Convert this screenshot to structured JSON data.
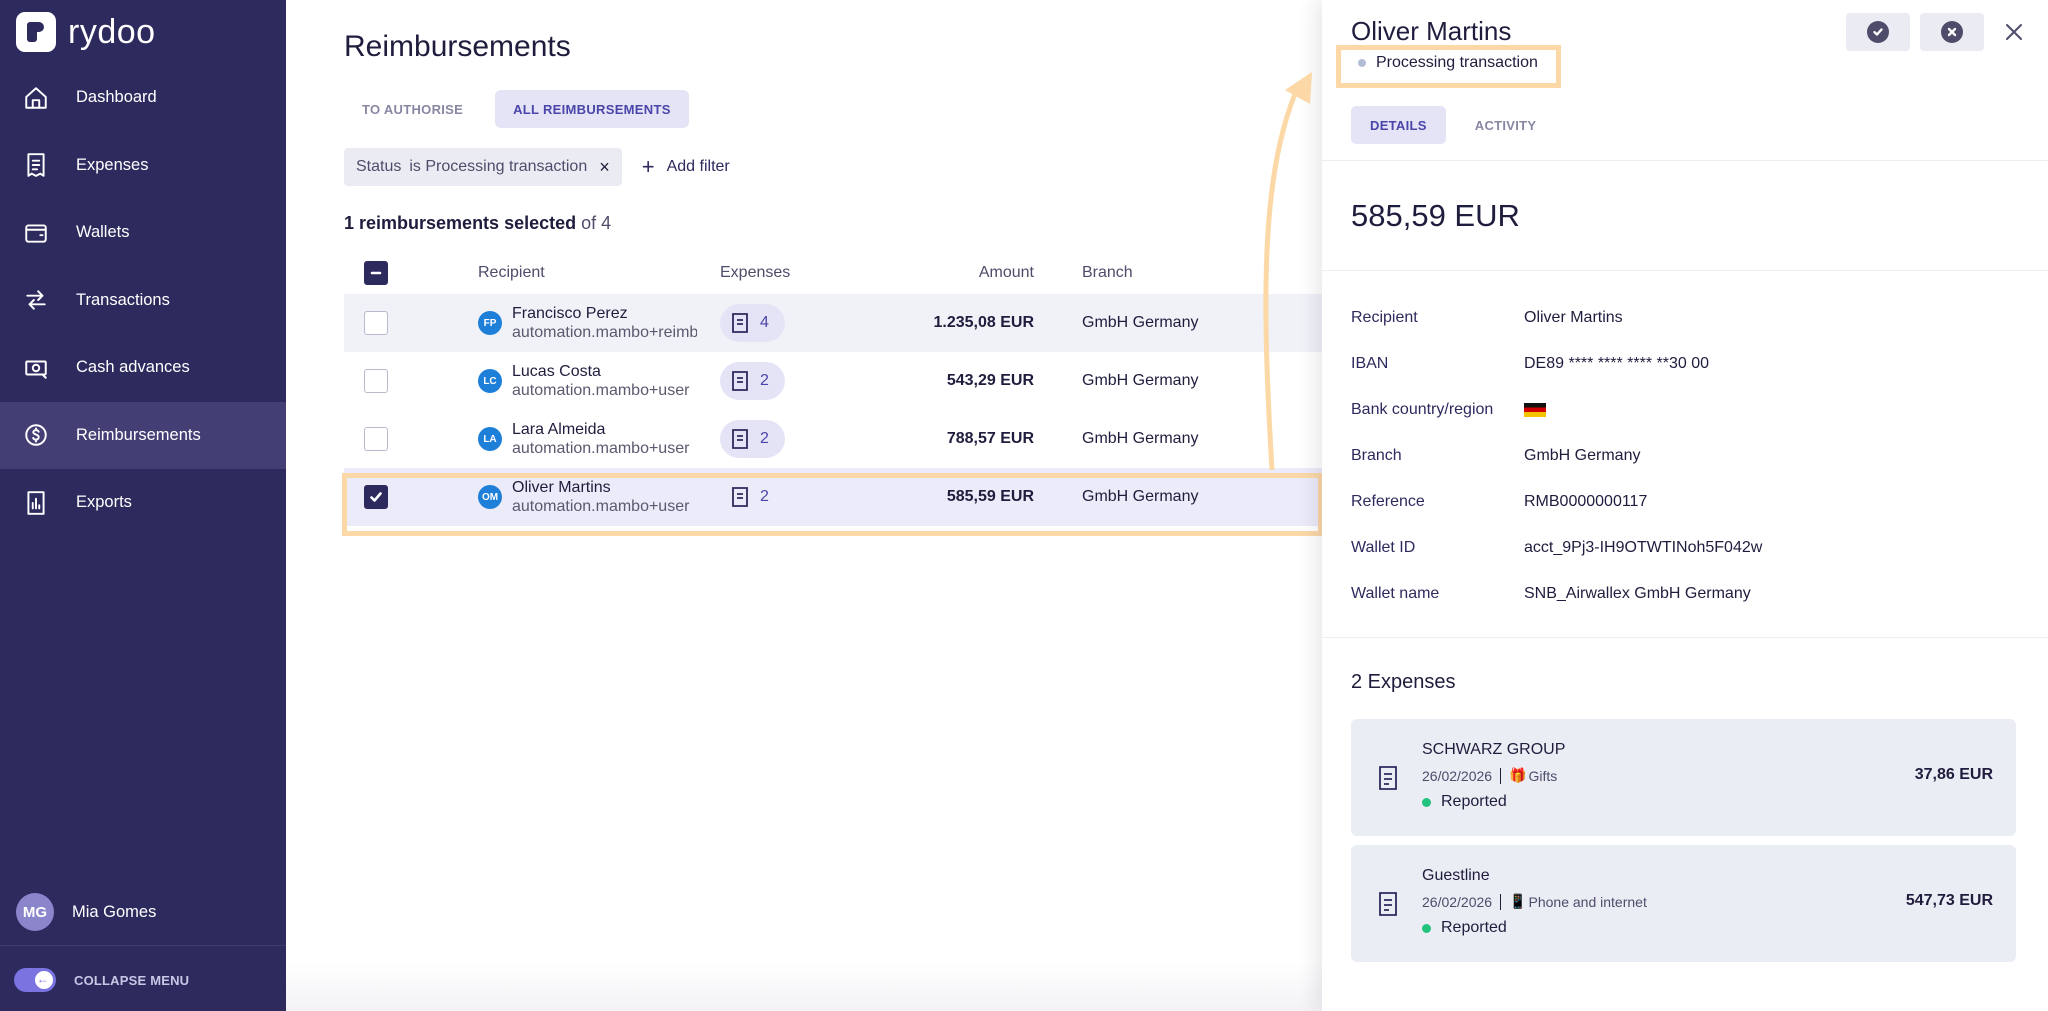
{
  "sidebar": {
    "logo_text": "rydoo",
    "items": [
      {
        "label": "Dashboard",
        "icon": "home-icon"
      },
      {
        "label": "Expenses",
        "icon": "receipt-icon"
      },
      {
        "label": "Wallets",
        "icon": "wallet-icon"
      },
      {
        "label": "Transactions",
        "icon": "transfer-icon"
      },
      {
        "label": "Cash advances",
        "icon": "cash-icon"
      },
      {
        "label": "Reimbursements",
        "icon": "reimburse-icon",
        "active": true
      },
      {
        "label": "Exports",
        "icon": "chart-icon"
      }
    ],
    "user": {
      "initials": "MG",
      "name": "Mia Gomes"
    },
    "collapse_label": "COLLAPSE MENU"
  },
  "main": {
    "title": "Reimbursements",
    "tabs": [
      {
        "label": "TO AUTHORISE",
        "active": false
      },
      {
        "label": "ALL REIMBURSEMENTS",
        "active": true
      }
    ],
    "filter": {
      "key": "Status",
      "value": "is Processing transaction"
    },
    "add_filter_label": "Add filter",
    "selection": {
      "count_text": "1 reimbursements selected",
      "of_text": "of 4"
    },
    "columns": {
      "recipient": "Recipient",
      "expenses": "Expenses",
      "amount": "Amount",
      "branch": "Branch"
    },
    "rows": [
      {
        "initials": "FP",
        "name": "Francisco Perez",
        "email": "automation.mambo+reimb",
        "expenses": "4",
        "amount": "1.235,08 EUR",
        "branch": "GmbH Germany",
        "checked": false
      },
      {
        "initials": "LC",
        "name": "Lucas Costa",
        "email": "automation.mambo+user",
        "expenses": "2",
        "amount": "543,29 EUR",
        "branch": "GmbH Germany",
        "checked": false
      },
      {
        "initials": "LA",
        "name": "Lara Almeida",
        "email": "automation.mambo+user",
        "expenses": "2",
        "amount": "788,57 EUR",
        "branch": "GmbH Germany",
        "checked": false
      },
      {
        "initials": "OM",
        "name": "Oliver Martins",
        "email": "automation.mambo+user",
        "expenses": "2",
        "amount": "585,59 EUR",
        "branch": "GmbH Germany",
        "checked": true
      }
    ]
  },
  "panel": {
    "name": "Oliver Martins",
    "status": "Processing transaction",
    "tabs": [
      {
        "label": "DETAILS",
        "active": true
      },
      {
        "label": "ACTIVITY",
        "active": false
      }
    ],
    "amount": "585,59 EUR",
    "details": [
      {
        "label": "Recipient",
        "value": "Oliver Martins"
      },
      {
        "label": "IBAN",
        "value": "DE89 **** **** **** **30 00"
      },
      {
        "label": "Bank country/region",
        "value": ""
      },
      {
        "label": "Branch",
        "value": "GmbH Germany"
      },
      {
        "label": "Reference",
        "value": "RMB0000000117"
      },
      {
        "label": "Wallet ID",
        "value": "acct_9Pj3-IH9OTWTINoh5F042w"
      },
      {
        "label": "Wallet name",
        "value": "SNB_Airwallex GmbH Germany"
      }
    ],
    "expenses_title": "2 Expenses",
    "expenses": [
      {
        "merchant": "SCHWARZ GROUP",
        "date": "26/02/2026",
        "category_emoji": "🎁",
        "category": "Gifts",
        "status": "Reported",
        "amount": "37,86 EUR"
      },
      {
        "merchant": "Guestline",
        "date": "26/02/2026",
        "category_emoji": "📱",
        "category": "Phone and internet",
        "status": "Reported",
        "amount": "547,73 EUR"
      }
    ]
  },
  "colors": {
    "sidebar_bg": "#2d2a5e",
    "accent": "#4a45a8",
    "highlight": "#fbd8a6",
    "reported": "#22c37c"
  }
}
